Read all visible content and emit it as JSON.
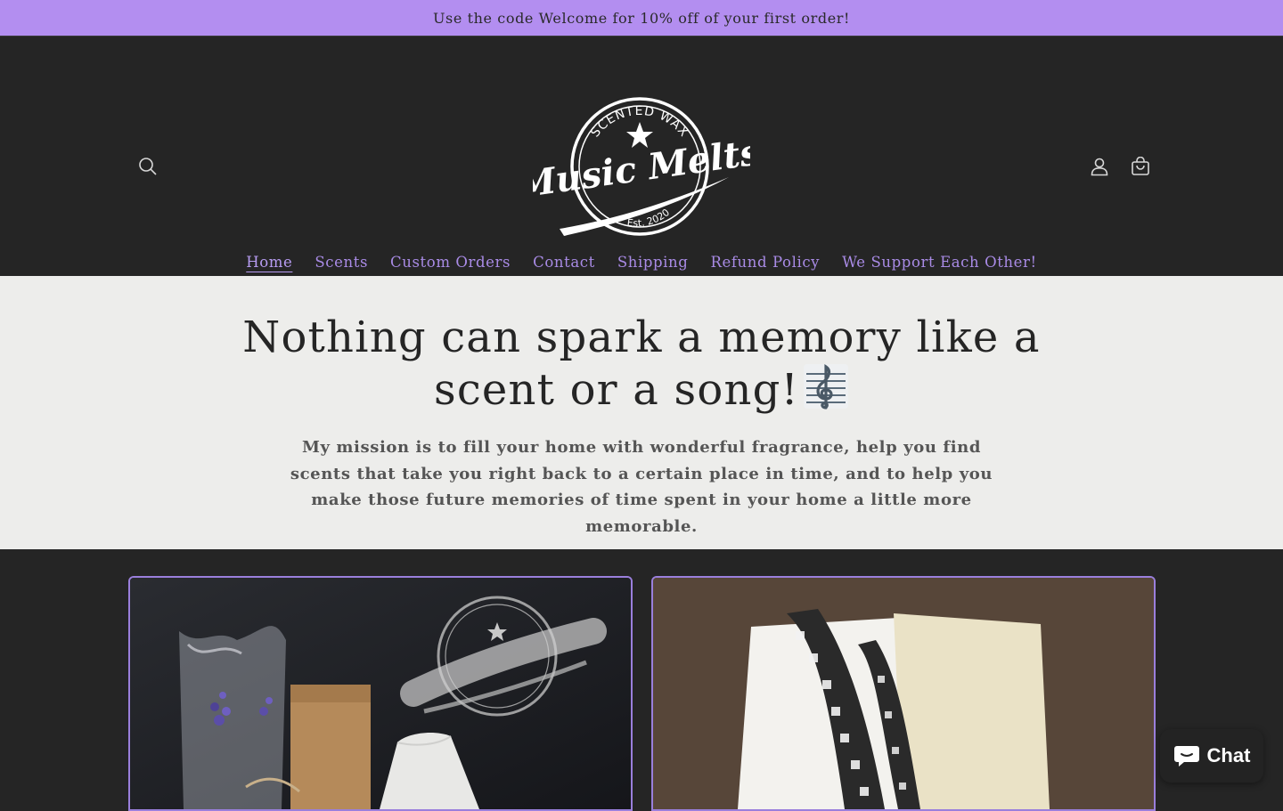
{
  "announcement": "Use the code Welcome for 10% off of your first order!",
  "header": {
    "logo": {
      "top_text": "SCENTED WAX",
      "brand": "Music Melts",
      "est": "Est. 2020"
    }
  },
  "nav": [
    {
      "label": "Home",
      "active": true
    },
    {
      "label": "Scents"
    },
    {
      "label": "Custom Orders"
    },
    {
      "label": "Contact"
    },
    {
      "label": "Shipping"
    },
    {
      "label": "Refund Policy"
    },
    {
      "label": "We Support Each Other!"
    }
  ],
  "hero": {
    "heading_line1": "Nothing can spark a memory like a",
    "heading_line2": "scent or a song!",
    "body": "My mission is to fill your home with wonderful fragrance, help you find scents that take you right back to a certain place in time, and to help you make those future memories of time spent in your home a little more memorable."
  },
  "chat": {
    "label": "Chat"
  },
  "colors": {
    "accent": "#b38ef0",
    "nav": "#a98be6",
    "dark": "#252525",
    "hero_bg": "#ededeb"
  }
}
